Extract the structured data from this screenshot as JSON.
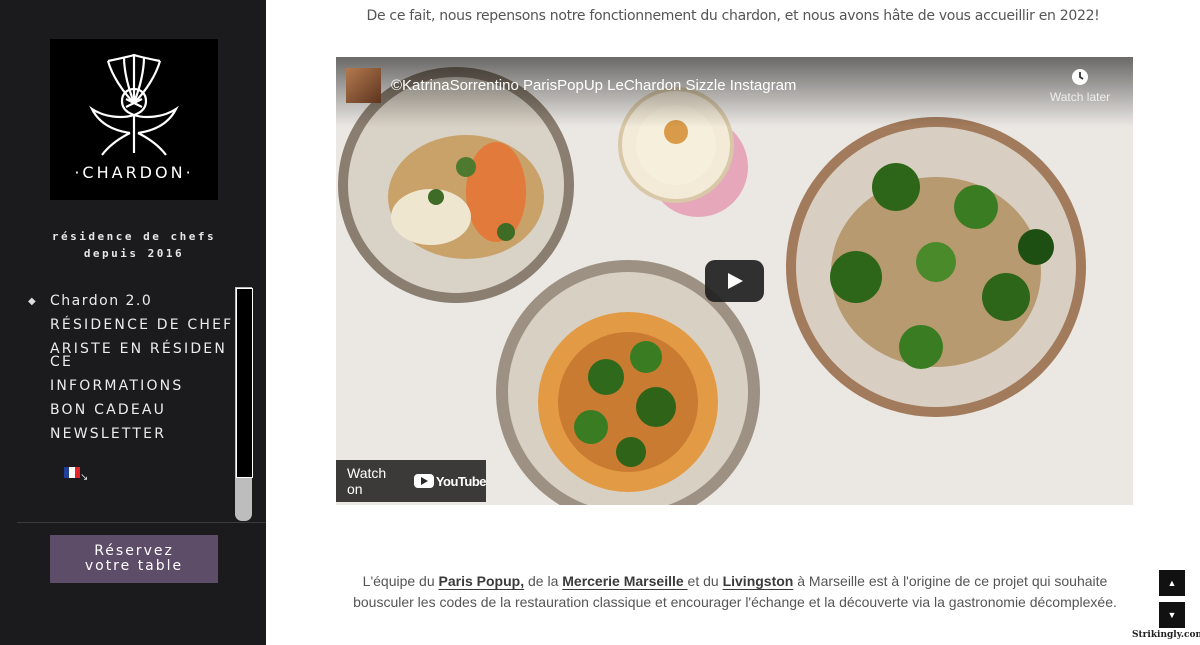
{
  "sidebar": {
    "logo_text": "·CHARDON·",
    "tagline_line1": "résidence de chefs",
    "tagline_line2": "depuis 2016",
    "nav_items": [
      {
        "label": "Chardon 2.0"
      },
      {
        "label": "RÉSIDENCE DE CHEF"
      },
      {
        "label": "ARISTE EN RÉSIDENCE"
      },
      {
        "label": "INFORMATIONS"
      },
      {
        "label": "BON CADEAU"
      },
      {
        "label": "NEWSLETTER"
      }
    ],
    "language_icon": "french-flag-icon",
    "reserve_line1": "Réservez",
    "reserve_line2": "votre table",
    "reserve_color": "#5e4d68"
  },
  "main": {
    "intro": "De ce fait, nous repensons notre fonctionnement du chardon, et nous avons hâte de vous accueillir en 2022!",
    "video": {
      "title": "©KatrinaSorrentino ParisPopUp LeChardon Sizzle Instagram",
      "watch_later": "Watch later",
      "watch_on": "Watch on",
      "youtube_word": "YouTube"
    },
    "para": {
      "t1": "L'équipe du ",
      "l1": "Paris Popup,",
      "t2": " de la ",
      "l2": "Mercerie Marseille ",
      "t3": " et du ",
      "l3": "Livingston",
      "t4": " à Marseille est à l'origine de ce projet qui souhaite bousculer les codes de la restauration classique et encourager l'échange et la découverte via la gastronomie décomplexée."
    }
  },
  "controls": {
    "up": "▲",
    "down": "▼",
    "badge": "Strikingly.com"
  }
}
